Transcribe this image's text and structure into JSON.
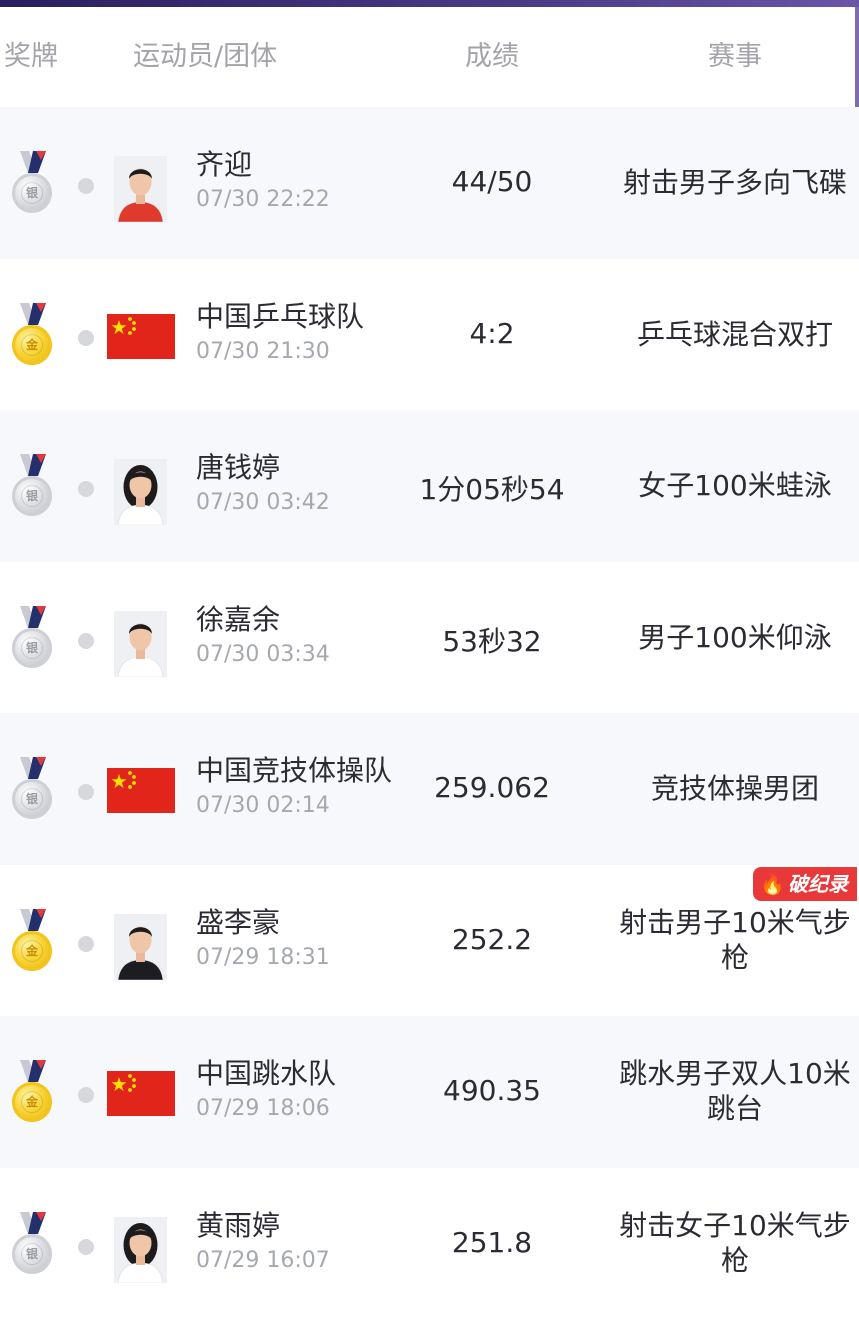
{
  "header": {
    "medal": "奖牌",
    "athlete": "运动员/团体",
    "score": "成绩",
    "event": "赛事"
  },
  "colors": {
    "gold": "#f7d232",
    "silver": "#c8c9ce",
    "flag_red": "#e1251b",
    "flag_star": "#ffde00",
    "record_badge": "#e8383a"
  },
  "rows": [
    {
      "medal": "silver",
      "medal_label": "银",
      "avatar_type": "photo",
      "name": "齐迎",
      "time": "07/30 22:22",
      "score": "44/50",
      "event": "射击男子多向飞碟",
      "record": ""
    },
    {
      "medal": "gold",
      "medal_label": "金",
      "avatar_type": "flag",
      "name": "中国乒乓球队",
      "time": "07/30 21:30",
      "score": "4:2",
      "event": "乒乓球混合双打",
      "record": ""
    },
    {
      "medal": "silver",
      "medal_label": "银",
      "avatar_type": "photo",
      "name": "唐钱婷",
      "time": "07/30 03:42",
      "score": "1分05秒54",
      "event": "女子100米蛙泳",
      "record": ""
    },
    {
      "medal": "silver",
      "medal_label": "银",
      "avatar_type": "photo",
      "name": "徐嘉余",
      "time": "07/30 03:34",
      "score": "53秒32",
      "event": "男子100米仰泳",
      "record": ""
    },
    {
      "medal": "silver",
      "medal_label": "银",
      "avatar_type": "flag",
      "name": "中国竞技体操队",
      "time": "07/30 02:14",
      "score": "259.062",
      "event": "竞技体操男团",
      "record": ""
    },
    {
      "medal": "gold",
      "medal_label": "金",
      "avatar_type": "photo",
      "name": "盛李豪",
      "time": "07/29 18:31",
      "score": "252.2",
      "event": "射击男子10米气步枪",
      "record": "破纪录"
    },
    {
      "medal": "gold",
      "medal_label": "金",
      "avatar_type": "flag",
      "name": "中国跳水队",
      "time": "07/29 18:06",
      "score": "490.35",
      "event": "跳水男子双人10米跳台",
      "record": ""
    },
    {
      "medal": "silver",
      "medal_label": "银",
      "avatar_type": "photo",
      "name": "黄雨婷",
      "time": "07/29 16:07",
      "score": "251.8",
      "event": "射击女子10米气步枪",
      "record": ""
    }
  ]
}
